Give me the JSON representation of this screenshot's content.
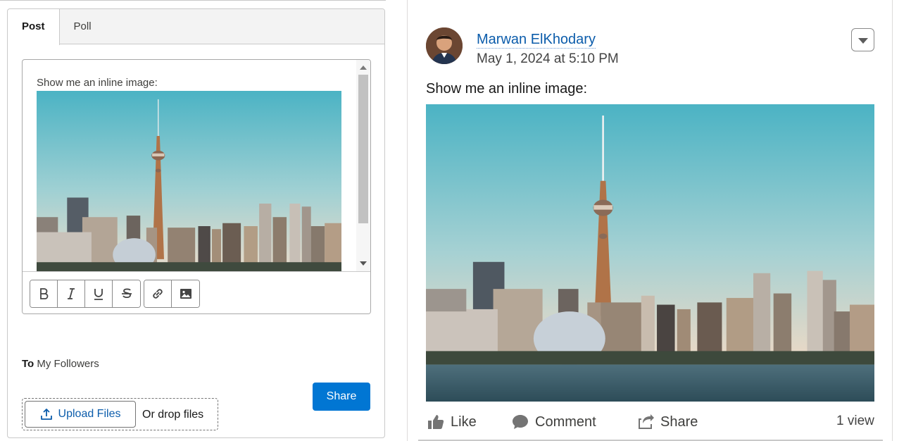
{
  "composer": {
    "tabs": [
      {
        "label": "Post",
        "active": true
      },
      {
        "label": "Poll",
        "active": false
      }
    ],
    "editor_text": "Show me an inline image:",
    "toolbar": {
      "format_buttons": [
        "bold-icon",
        "italic-icon",
        "underline-icon",
        "strikethrough-icon"
      ],
      "insert_buttons": [
        "link-icon",
        "image-icon"
      ]
    },
    "to_label": "To",
    "to_value": "My Followers",
    "upload_label": "Upload Files",
    "drop_label": "Or drop files",
    "share_label": "Share"
  },
  "post": {
    "author": "Marwan ElKhodary",
    "timestamp": "May 1, 2024 at 5:10 PM",
    "text": "Show me an inline image:",
    "actions": {
      "like": "Like",
      "comment": "Comment",
      "share": "Share"
    },
    "views": "1 view"
  },
  "colors": {
    "brand_blue": "#0176d3",
    "link_blue": "#0b5cab",
    "sky_top": "#4bb3c4",
    "sky_bottom": "#e9dccd"
  }
}
